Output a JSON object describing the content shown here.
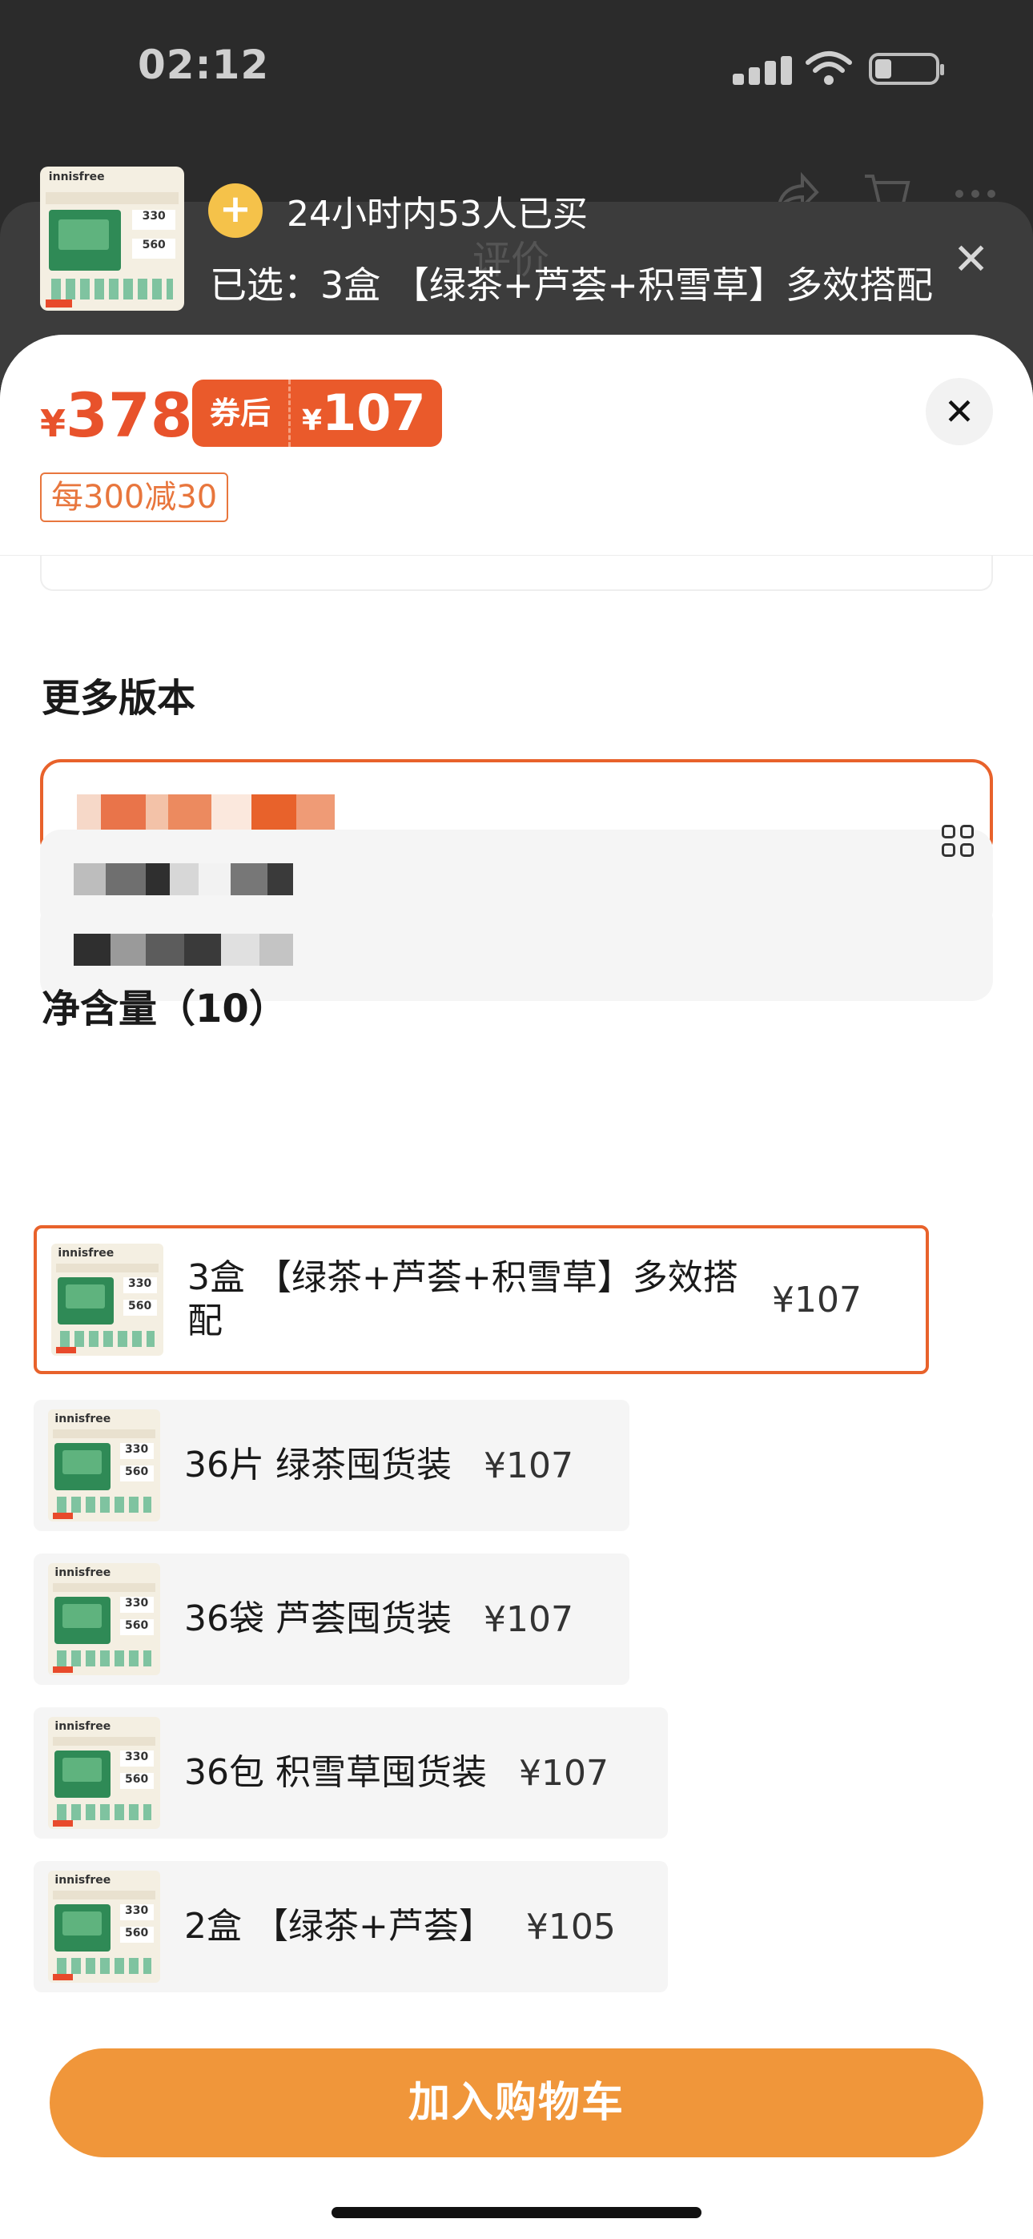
{
  "status_bar": {
    "time": "02:12"
  },
  "background_header": {
    "title": "评价",
    "icons": [
      "share-icon",
      "cart-icon",
      "more-icon"
    ]
  },
  "top_panel": {
    "buyers_text": "24小时内53人已买",
    "selected_text": "已选：3盒 【绿茶+芦荟+积雪草】多效搭配",
    "close_glyph": "✕"
  },
  "price": {
    "currency": "¥",
    "value": "378",
    "coupon_label": "券后",
    "coupon_currency": "¥",
    "coupon_value": "107",
    "promo_tag": "每300减30",
    "close_glyph": "✕"
  },
  "versions": {
    "title": "更多版本"
  },
  "net_content": {
    "title": "净含量（10）",
    "items": [
      {
        "name": "3盒 【绿茶+芦荟+积雪草】多效搭配",
        "price": "¥107"
      },
      {
        "name": "36片 绿茶囤货装",
        "price": "¥107"
      },
      {
        "name": "36袋 芦荟囤货装",
        "price": "¥107"
      },
      {
        "name": "36包 积雪草囤货装",
        "price": "¥107"
      },
      {
        "name": "2盒 【绿茶+芦荟】",
        "price": "¥105"
      }
    ]
  },
  "thumbnail": {
    "brand": "innisfree",
    "num1": "330",
    "num2": "560"
  },
  "cart_button": {
    "label": "加入购物车"
  },
  "colors": {
    "accent": "#e8522b",
    "cart_button": "#f0963a",
    "selected_border": "#e8622b"
  }
}
